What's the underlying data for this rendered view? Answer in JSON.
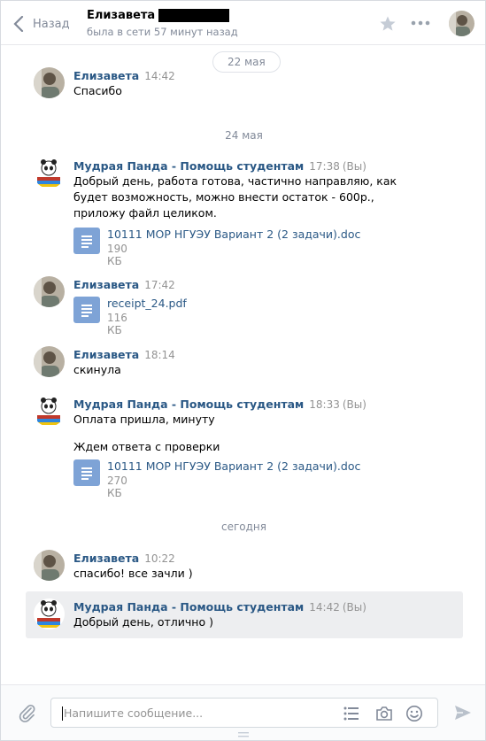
{
  "header": {
    "back_label": "Назад",
    "contact_name": "Елизавета",
    "status": "была в сети 57 минут назад"
  },
  "top_date": "22 мая",
  "date_separators": [
    "24 мая",
    "сегодня"
  ],
  "messages": [
    {
      "sender": "Елизавета",
      "time": "14:42",
      "text": "Спасибо"
    },
    {
      "sender": "Мудрая Панда - Помощь студентам",
      "time": "17:38",
      "you": "(Вы)",
      "text": "Добрый день, работа готова, частично направляю, как будет возможность, можно внести остаток - 600р., приложу файл целиком.",
      "file": {
        "name": "10111 МОР НГУЭУ Вариант 2 (2 задачи).doc",
        "size": "190 КБ"
      }
    },
    {
      "sender": "Елизавета",
      "time": "17:42",
      "file": {
        "name": "receipt_24.pdf",
        "size": "116 КБ"
      }
    },
    {
      "sender": "Елизавета",
      "time": "18:14",
      "text": "скинула"
    },
    {
      "sender": "Мудрая Панда - Помощь студентам",
      "time": "18:33",
      "you": "(Вы)",
      "text": "Оплата пришла, минуту",
      "text2": "Ждем ответа с проверки",
      "file": {
        "name": "10111 МОР НГУЭУ Вариант 2 (2 задачи).doc",
        "size": "270 КБ"
      }
    },
    {
      "sender": "Елизавета",
      "time": "10:22",
      "text": "спасибо! все зачли )"
    },
    {
      "sender": "Мудрая Панда - Помощь студентам",
      "time": "14:42",
      "you": "(Вы)",
      "text": "Добрый день, отлично )"
    }
  ],
  "composer": {
    "placeholder": "Напишите сообщение..."
  },
  "colors": {
    "link": "#2a5885",
    "muted": "#828a99",
    "file_icon": "#7ea3d6",
    "highlight": "#edeef0"
  },
  "icons": [
    "chevron-left-icon",
    "star-icon",
    "more-icon",
    "paperclip-icon",
    "list-icon",
    "camera-icon",
    "smile-icon",
    "send-icon",
    "document-icon"
  ]
}
